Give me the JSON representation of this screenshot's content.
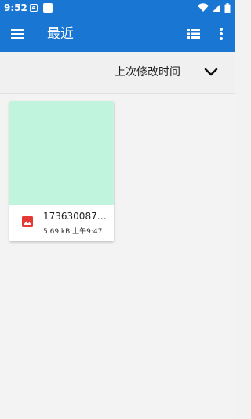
{
  "status_bar": {
    "time": "9:52",
    "notification_letter": "A",
    "icons": [
      "notification-a-icon",
      "notification-square-icon",
      "wifi-icon",
      "cellular-icon",
      "battery-icon"
    ]
  },
  "app_bar": {
    "title": "最近",
    "icons": [
      "menu-icon",
      "list-view-icon",
      "more-vert-icon"
    ],
    "color": "#1976d2"
  },
  "sort_bar": {
    "label": "上次修改时间",
    "icon": "chevron-down-icon"
  },
  "files": [
    {
      "name": "173630087…",
      "size": "5.69 kB",
      "time": "上午9:47",
      "meta": "5.69 kB  上午9:47",
      "type_icon": "image-file-icon",
      "thumbnail_color": "#c1f4dd"
    }
  ]
}
